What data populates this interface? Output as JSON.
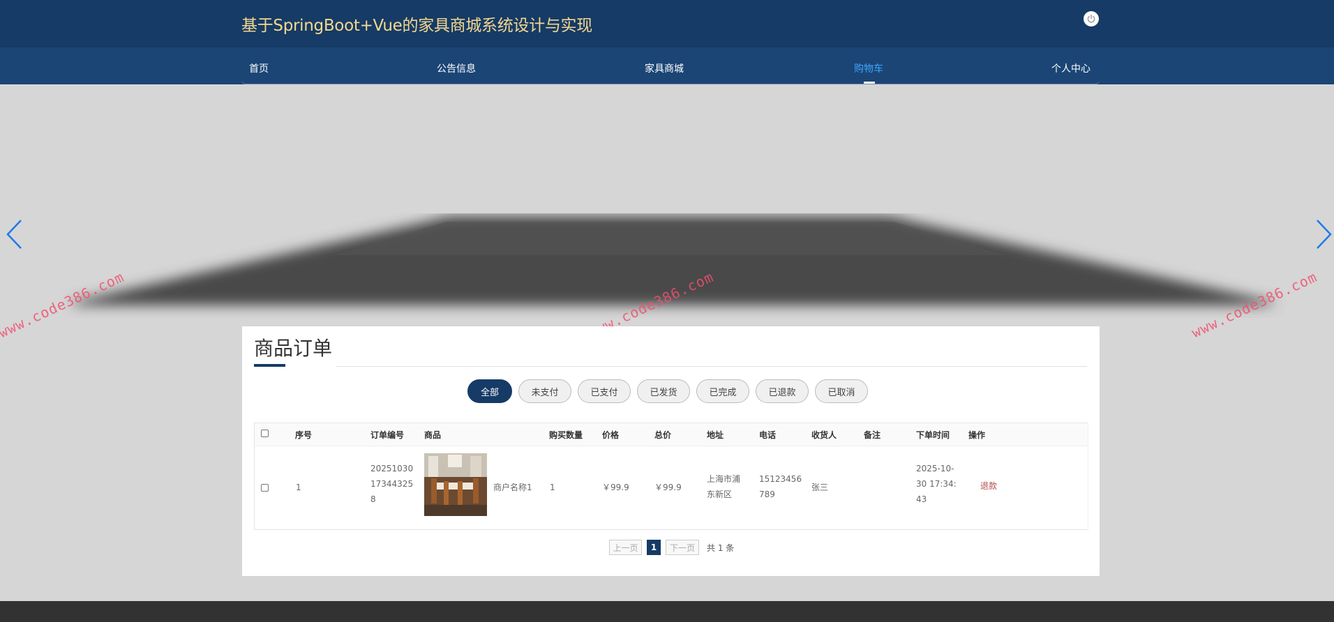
{
  "header": {
    "title": "基于SpringBoot+Vue的家具商城系统设计与实现"
  },
  "nav": {
    "items": [
      {
        "label": "首页"
      },
      {
        "label": "公告信息"
      },
      {
        "label": "家具商城"
      },
      {
        "label": "购物车"
      },
      {
        "label": "个人中心"
      }
    ],
    "active": "购物车"
  },
  "watermark": "www.code386.com",
  "panel": {
    "title": "商品订单",
    "filters": [
      "全部",
      "未支付",
      "已支付",
      "已发货",
      "已完成",
      "已退款",
      "已取消"
    ],
    "active_filter": "全部"
  },
  "table": {
    "columns": [
      "序号",
      "订单编号",
      "商品",
      "购买数量",
      "价格",
      "总价",
      "地址",
      "电话",
      "收货人",
      "备注",
      "下单时间",
      "操作"
    ],
    "rows": [
      {
        "index": "1",
        "order_no_lines": [
          "20251030",
          "17344325",
          "8"
        ],
        "product_name": "商户名称1",
        "quantity": "1",
        "price": "￥99.9",
        "total": "￥99.9",
        "address_lines": [
          "上海市浦",
          "东新区"
        ],
        "phone_lines": [
          "15123456",
          "789"
        ],
        "receiver": "张三",
        "remark": "",
        "time_lines": [
          "2025-10-",
          "30 17:34:",
          "43"
        ],
        "action": "退款"
      }
    ]
  },
  "pagination": {
    "prev": "上一页",
    "current": "1",
    "next": "下一页",
    "total": "共 1 条"
  },
  "colors": {
    "header": "#153b66",
    "navbar": "#1b4575",
    "title": "#f5d78f",
    "active_nav": "#3ea6ff",
    "accent": "#153b66"
  },
  "icons": {
    "power": "power-icon",
    "prev": "chevron-left-icon",
    "next": "chevron-right-icon"
  }
}
